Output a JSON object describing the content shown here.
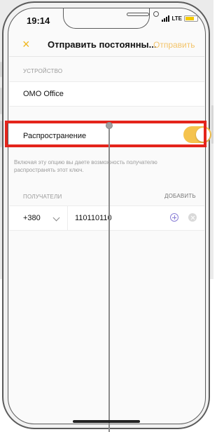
{
  "status_bar": {
    "time": "19:14",
    "network": "LTE",
    "battery_color": "#f4c900"
  },
  "nav": {
    "close_icon": "×",
    "title": "Отправить постоянны...",
    "send_label": "Отправить"
  },
  "device_section": {
    "label": "УСТРОЙСТВО",
    "device_name": "OMO Office"
  },
  "share_section": {
    "label": "Распространение",
    "toggle_on": true,
    "help_text": "Включая эту опцию вы даете возможность получателю распространять этот ключ.",
    "accent_color": "#f5c34d"
  },
  "recipients_section": {
    "label": "ПОЛУЧАТЕЛИ",
    "add_label": "ДОБАВИТЬ",
    "recipient": {
      "country_code": "+380",
      "phone": "110110110"
    }
  },
  "annotation": {
    "highlight_color": "#e4241b"
  }
}
